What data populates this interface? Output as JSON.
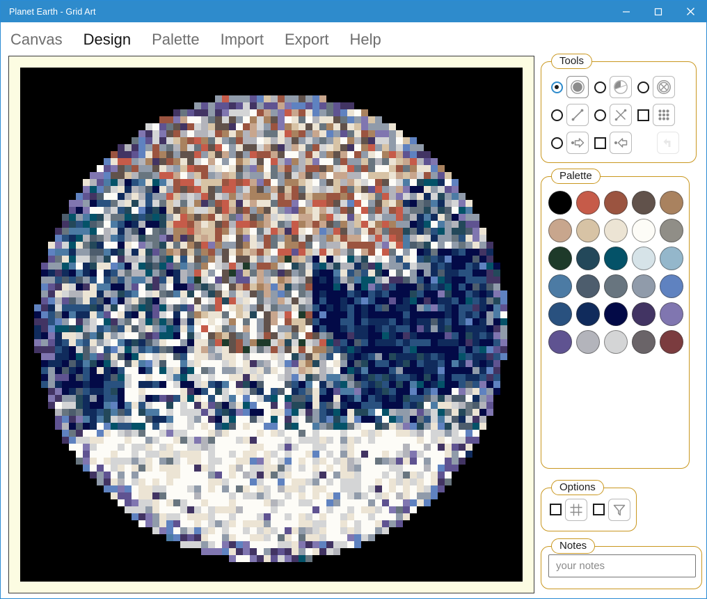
{
  "window": {
    "title": "Planet Earth - Grid Art",
    "titlebar_color": "#2e8bcc",
    "controls": [
      {
        "name": "minimize-button",
        "glyph": "minimize"
      },
      {
        "name": "maximize-button",
        "glyph": "maximize"
      },
      {
        "name": "close-button",
        "glyph": "close"
      }
    ]
  },
  "menu": {
    "items": [
      {
        "label": "Canvas",
        "active": false
      },
      {
        "label": "Design",
        "active": true
      },
      {
        "label": "Palette",
        "active": false
      },
      {
        "label": "Import",
        "active": false
      },
      {
        "label": "Export",
        "active": false
      },
      {
        "label": "Help",
        "active": false
      }
    ]
  },
  "canvas": {
    "name": "artwork-canvas",
    "mat_color": "#fcfce2",
    "background_color": "#000000",
    "subject": "pixelated planet earth"
  },
  "tools": {
    "legend": "Tools",
    "rows": [
      {
        "items": [
          {
            "control": "radio",
            "checked": true,
            "icon": "filled-circle-icon",
            "button_name": "tool-filled-circle"
          },
          {
            "control": "radio",
            "checked": false,
            "icon": "half-circle-icon",
            "button_name": "tool-half-circle"
          },
          {
            "control": "radio",
            "checked": false,
            "icon": "crossed-circle-icon",
            "button_name": "tool-crossed-circle"
          }
        ]
      },
      {
        "items": [
          {
            "control": "radio",
            "checked": false,
            "icon": "line-icon",
            "button_name": "tool-line"
          },
          {
            "control": "radio",
            "checked": false,
            "icon": "cross-lines-icon",
            "button_name": "tool-cross-lines"
          },
          {
            "control": "checkbox",
            "checked": false,
            "icon": "dot-grid-icon",
            "button_name": "tool-dot-grid"
          }
        ]
      },
      {
        "items": [
          {
            "control": "radio",
            "checked": false,
            "icon": "arrow-right-icon",
            "button_name": "tool-arrow-right"
          },
          {
            "control": "checkbox",
            "checked": false,
            "icon": "arrow-left-icon",
            "button_name": "tool-arrow-left"
          },
          {
            "control": "none",
            "checked": false,
            "icon": "undo-icon",
            "button_name": "tool-undo",
            "disabled": true
          }
        ]
      }
    ]
  },
  "palette": {
    "legend": "Palette",
    "colors": [
      "#000000",
      "#c65b49",
      "#9b5440",
      "#61524b",
      "#a9825f",
      "#c8a68d",
      "#d7c3a5",
      "#ece4d4",
      "#fdfcf7",
      "#908e87",
      "#1e3a2a",
      "#23485a",
      "#045268",
      "#d6e3e8",
      "#94b7cb",
      "#4c7ba4",
      "#4d5d6d",
      "#68757f",
      "#909baa",
      "#5f82c0",
      "#29517f",
      "#102b5c",
      "#030a47",
      "#423463",
      "#8076b0",
      "#5f5391",
      "#b3b4bb",
      "#d4d5d6",
      "#6a6468",
      "#7b3c3f"
    ]
  },
  "options": {
    "legend": "Options",
    "items": [
      {
        "control": "checkbox",
        "checked": false,
        "icon": "grid-icon",
        "button_name": "option-grid"
      },
      {
        "control": "checkbox",
        "checked": false,
        "icon": "funnel-icon",
        "button_name": "option-filter"
      }
    ]
  },
  "notes": {
    "legend": "Notes",
    "placeholder": "your notes",
    "value": ""
  }
}
